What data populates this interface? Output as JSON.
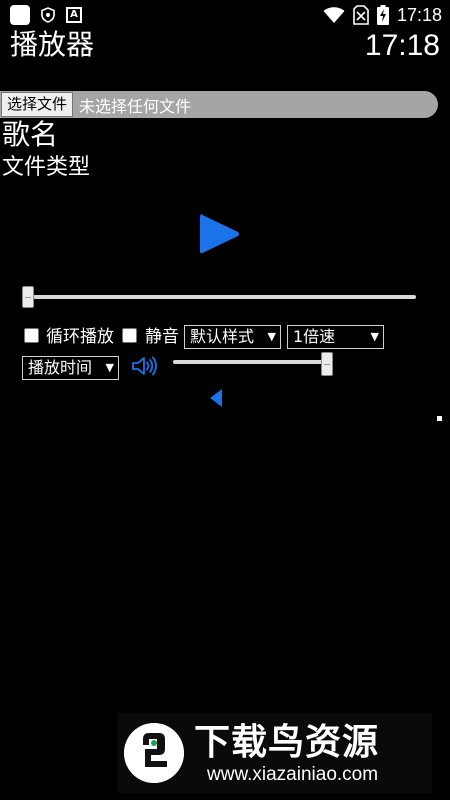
{
  "status_bar": {
    "time": "17:18",
    "icons": [
      "app-notification-icon",
      "shield-icon",
      "font-a-icon",
      "wifi-icon",
      "no-sim-icon",
      "battery-charging-icon"
    ]
  },
  "header": {
    "title": "播放器",
    "clock": "17:18"
  },
  "file_picker": {
    "button_label": "选择文件",
    "status": "未选择任何文件"
  },
  "song": {
    "name": "歌名",
    "file_type": "文件类型"
  },
  "player": {
    "play_icon": "play-icon",
    "progress": 0,
    "loop_label": "循环播放",
    "loop_checked": false,
    "mute_label": "静音",
    "mute_checked": false,
    "style_select": "默认样式",
    "speed_select": "1倍速",
    "time_select": "播放时间",
    "volume_icon": "volume-icon",
    "volume": 1.0,
    "collapse_icon": "caret-left-icon",
    "accent_color": "#1a73e8"
  },
  "watermark": {
    "title": "下载鸟资源",
    "url": "www.xiazainiao.com"
  }
}
